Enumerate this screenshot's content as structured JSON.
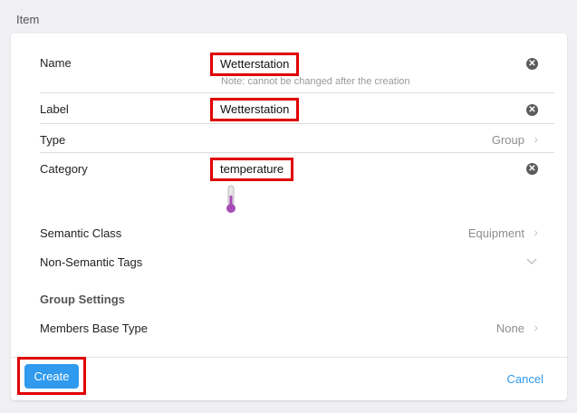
{
  "section_title": "Item",
  "fields": {
    "name": {
      "label": "Name",
      "value": "Wetterstation",
      "note": "Note: cannot be changed after the creation"
    },
    "label": {
      "label": "Label",
      "value": "Wetterstation"
    },
    "type": {
      "label": "Type",
      "value": "Group"
    },
    "category": {
      "label": "Category",
      "value": "temperature",
      "icon": "thermometer-icon"
    },
    "semantic_class": {
      "label": "Semantic Class",
      "value": "Equipment"
    },
    "non_semantic_tags": {
      "label": "Non-Semantic Tags"
    }
  },
  "group_settings": {
    "title": "Group Settings",
    "members_base_type": {
      "label": "Members Base Type",
      "value": "None"
    }
  },
  "actions": {
    "create": "Create",
    "cancel": "Cancel"
  },
  "colors": {
    "accent": "#2f9aee",
    "highlight": "#e00000",
    "thermometer": "#a64db8"
  }
}
